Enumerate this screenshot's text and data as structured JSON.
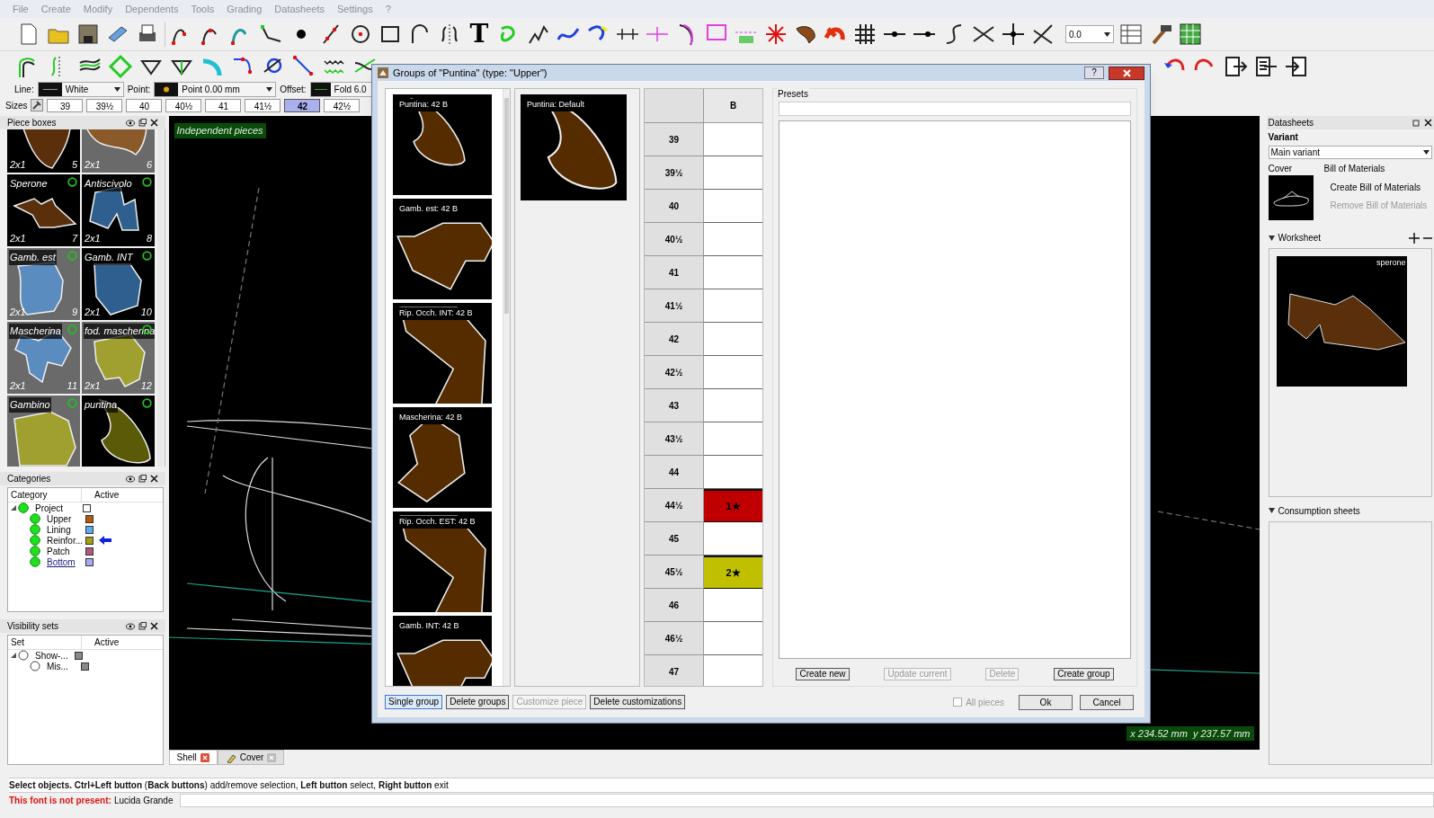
{
  "menu": [
    "File",
    "Create",
    "Modify",
    "Dependents",
    "Tools",
    "Grading",
    "Datasheets",
    "Settings",
    "?"
  ],
  "toolbar": {
    "text_tool_glyph": "T",
    "zoom_value": "0.0"
  },
  "properties": {
    "line_label": "Line:",
    "line_value": "White",
    "point_label": "Point:",
    "point_value": "Point 0.00 mm",
    "offset_label": "Offset:",
    "offset_value": "Fold 6.0"
  },
  "sizes": {
    "label": "Sizes",
    "items": [
      {
        "label": "39",
        "selected": false
      },
      {
        "label": "39½",
        "selected": false
      },
      {
        "label": "40",
        "selected": false
      },
      {
        "label": "40½",
        "selected": false
      },
      {
        "label": "41",
        "selected": false
      },
      {
        "label": "41½",
        "selected": false
      },
      {
        "label": "42",
        "selected": true
      },
      {
        "label": "42½",
        "selected": false
      }
    ]
  },
  "piece_boxes": {
    "title": "Piece boxes",
    "items": [
      {
        "quantity": "2x1",
        "number": "5",
        "color": "#5a300c",
        "dimmed": false
      },
      {
        "quantity": "2x1",
        "number": "6",
        "color": "#8a5a2a",
        "dimmed": true
      },
      {
        "label": "Sperone",
        "quantity": "2x1",
        "number": "7",
        "color": "#5a300c",
        "dimmed": false,
        "marked": true
      },
      {
        "label": "Antiscivolo",
        "quantity": "2x1",
        "number": "8",
        "color": "#2f5f8f",
        "dimmed": false,
        "marked": true
      },
      {
        "label": "Gamb. est",
        "quantity": "2x1",
        "number": "9",
        "color": "#5b8cc0",
        "dimmed": true,
        "marked": true
      },
      {
        "label": "Gamb. INT",
        "quantity": "2x1",
        "number": "10",
        "color": "#2f5f8f",
        "dimmed": false,
        "marked": true
      },
      {
        "label": "Mascherina",
        "quantity": "2x1",
        "number": "11",
        "color": "#5b8cc0",
        "dimmed": true,
        "marked": true
      },
      {
        "label": "fod. mascherina",
        "quantity": "2x1",
        "number": "12",
        "color": "#a0a030",
        "dimmed": true,
        "marked": true
      },
      {
        "label": "Gambino",
        "color": "#a0a030",
        "dimmed": true,
        "marked": true
      },
      {
        "label": "puntina",
        "color": "#5a5a08",
        "dimmed": false,
        "marked": true
      }
    ]
  },
  "categories": {
    "title": "Categories",
    "columns": [
      "Category",
      "Active"
    ],
    "items": [
      {
        "label": "Project",
        "color": "#ffffff",
        "pointer": false,
        "underlined": false,
        "expanded": true,
        "children": [
          {
            "label": "Upper",
            "color": "#b35a10",
            "pointer": false,
            "underlined": false
          },
          {
            "label": "Lining",
            "color": "#5aacf0",
            "pointer": false,
            "underlined": false
          },
          {
            "label": "Reinfor...",
            "color": "#a0a010",
            "pointer": true,
            "underlined": false
          },
          {
            "label": "Patch",
            "color": "#b05a80",
            "pointer": false,
            "underlined": false
          },
          {
            "label": "Bottom",
            "color": "#a8a8f0",
            "pointer": false,
            "underlined": true
          }
        ]
      }
    ]
  },
  "visibility_sets": {
    "title": "Visibility sets",
    "columns": [
      "Set",
      "Active"
    ],
    "items": [
      {
        "label": "Show-...",
        "expanded": true,
        "children": [
          {
            "label": "Mis..."
          }
        ]
      }
    ]
  },
  "canvas": {
    "label": "Independent pieces",
    "coordinates": "x 234.52 mm  y 237.57 mm"
  },
  "bottom_tabs": [
    {
      "label": "Shell",
      "closable": true,
      "selected": true
    },
    {
      "label": "Cover",
      "closable": true,
      "selected": false
    }
  ],
  "status": {
    "message": "**Select objects.** **Ctrl+Left button** (**Back buttons**) add/remove selection, **Left button** select, **Right button** exit",
    "font_warning": "This font is not present:",
    "font_name": "Lucida Grande"
  },
  "datasheets": {
    "title": "Datasheets",
    "variant_label": "Variant",
    "variant_value": "Main variant",
    "cover_label": "Cover",
    "bom_label": "Bill of Materials",
    "actions": [
      {
        "label": "Create Bill of Materials",
        "disabled": false
      },
      {
        "label": "Remove Bill of Materials",
        "disabled": true
      }
    ],
    "worksheet_label": "Worksheet",
    "worksheet_tag": "sperone",
    "consumption_label": "Consumption sheets"
  },
  "dialog": {
    "title": "Groups of \"Puntina\" (type: \"Upper\")",
    "groups": [
      "Puntina: 42 B",
      "Gamb. est: 42 B",
      "Rip. Occh. INT: 42 B",
      "Mascherina: 42 B",
      "Rip. Occh. EST: 42 B",
      "Gamb. INT: 42 B"
    ],
    "preview": "Puntina: Default",
    "table_header": "B",
    "rows": [
      {
        "size": "39",
        "value": "",
        "color": "#ffffff"
      },
      {
        "size": "39½",
        "value": "",
        "color": "#ffffff"
      },
      {
        "size": "40",
        "value": "",
        "color": "#ffffff"
      },
      {
        "size": "40½",
        "value": "",
        "color": "#ffffff"
      },
      {
        "size": "41",
        "value": "",
        "color": "#ffffff"
      },
      {
        "size": "41½",
        "value": "",
        "color": "#ffffff"
      },
      {
        "size": "42",
        "value": "",
        "color": "#ffffff"
      },
      {
        "size": "42½",
        "value": "",
        "color": "#ffffff"
      },
      {
        "size": "43",
        "value": "",
        "color": "#ffffff"
      },
      {
        "size": "43½",
        "value": "",
        "color": "#ffffff"
      },
      {
        "size": "44",
        "value": "",
        "color": "#ffffff"
      },
      {
        "size": "44½",
        "value": "1★",
        "color": "#c00000"
      },
      {
        "size": "45",
        "value": "",
        "color": "#ffffff"
      },
      {
        "size": "45½",
        "value": "2★",
        "color": "#c0c000"
      },
      {
        "size": "46",
        "value": "",
        "color": "#ffffff"
      },
      {
        "size": "46½",
        "value": "",
        "color": "#ffffff"
      },
      {
        "size": "47",
        "value": "",
        "color": "#ffffff"
      }
    ],
    "presets_label": "Presets",
    "preset_buttons": [
      {
        "label": "Create new",
        "disabled": false
      },
      {
        "label": "Update current",
        "disabled": true
      },
      {
        "label": "Delete",
        "disabled": true
      },
      {
        "label": "Create group",
        "disabled": false
      }
    ],
    "left_buttons": [
      {
        "label": "Single group",
        "disabled": false,
        "selected": true
      },
      {
        "label": "Delete groups",
        "disabled": false,
        "selected": false
      },
      {
        "label": "Customize piece",
        "disabled": true,
        "selected": false
      },
      {
        "label": "Delete customizations",
        "disabled": false,
        "selected": false
      }
    ],
    "all_pieces": {
      "label": "All pieces",
      "checked": false,
      "disabled": true
    },
    "ok": "Ok",
    "cancel": "Cancel",
    "help": "?"
  }
}
